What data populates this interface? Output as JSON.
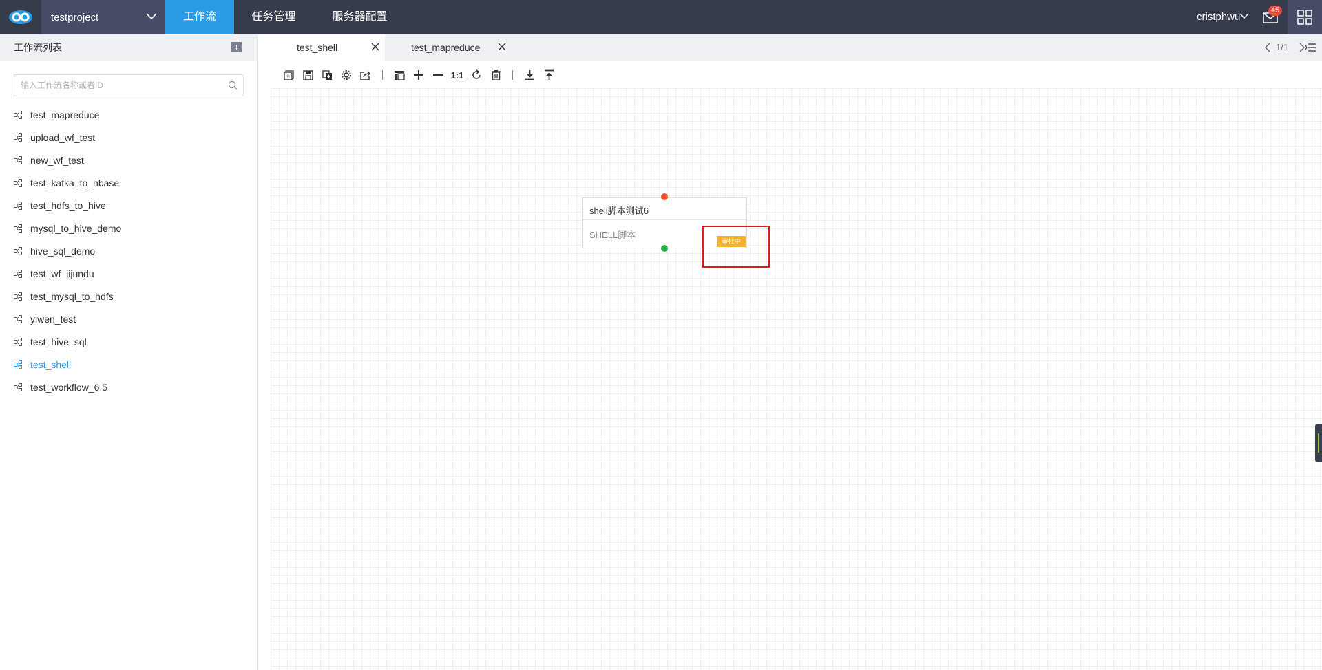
{
  "header": {
    "project": "testproject",
    "nav": [
      "工作流",
      "任务管理",
      "服务器配置"
    ],
    "active_nav": 0,
    "user": "cristphwu",
    "mail_count": "45"
  },
  "sidebar": {
    "title": "工作流列表",
    "search_placeholder": "输入工作流名称或者ID",
    "items": [
      "test_mapreduce",
      "upload_wf_test",
      "new_wf_test",
      "test_kafka_to_hbase",
      "test_hdfs_to_hive",
      "mysql_to_hive_demo",
      "hive_sql_demo",
      "test_wf_jijundu",
      "test_mysql_to_hdfs",
      "yiwen_test",
      "test_hive_sql",
      "test_shell",
      "test_workflow_6.5"
    ],
    "active_item": "test_shell"
  },
  "tabs": [
    {
      "label": "test_shell",
      "active": true
    },
    {
      "label": "test_mapreduce",
      "active": false
    }
  ],
  "pager": "1/1",
  "toolbar": {
    "zoom_reset_label": "1:1"
  },
  "canvas": {
    "node": {
      "title": "shell脚本测试6",
      "type": "SHELL脚本",
      "status": "审批中"
    }
  },
  "colors": {
    "topbar": "#363b4c",
    "accent": "#2b9be8",
    "status_badge": "#f3b231",
    "port_in": "#f0542d",
    "port_out": "#29b24a",
    "highlight": "#e21a1a"
  }
}
